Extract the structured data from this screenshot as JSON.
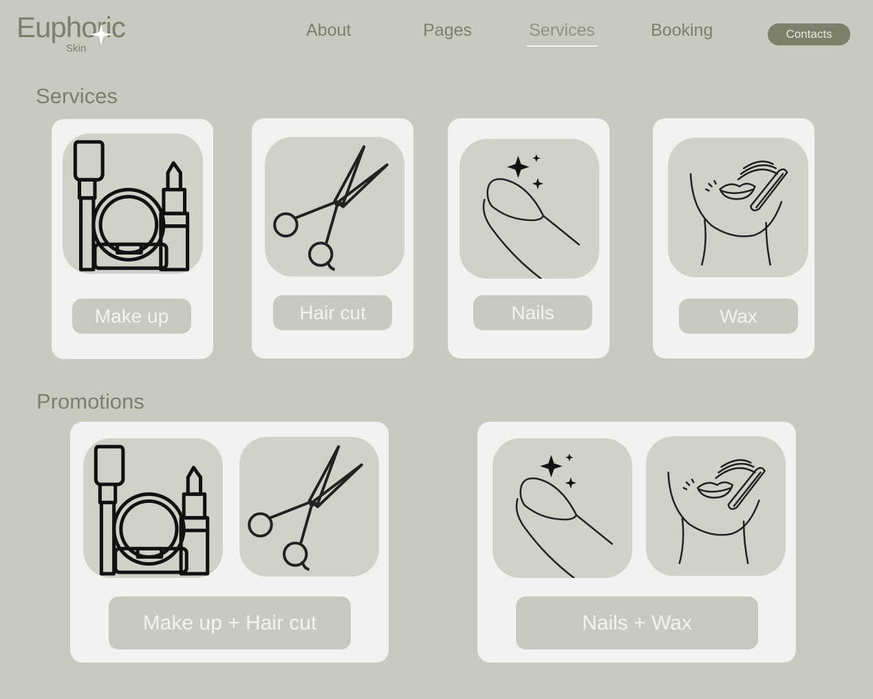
{
  "brand": {
    "name": "Euphoric",
    "sub": "Skin"
  },
  "nav": {
    "about": "About",
    "pages": "Pages",
    "services": "Services",
    "booking": "Booking",
    "contacts": "Contacts"
  },
  "services_section": {
    "title": "Services",
    "items": [
      {
        "label": "Make up",
        "icon": "makeup-icon"
      },
      {
        "label": "Hair cut",
        "icon": "scissors-icon"
      },
      {
        "label": "Nails",
        "icon": "nail-icon"
      },
      {
        "label": "Wax",
        "icon": "wax-icon"
      }
    ]
  },
  "promotions_section": {
    "title": "Promotions",
    "items": [
      {
        "label": "Make up + Hair cut",
        "icons": [
          "makeup-icon",
          "scissors-icon"
        ]
      },
      {
        "label": "Nails + Wax",
        "icons": [
          "nail-icon",
          "wax-icon"
        ]
      }
    ]
  },
  "colors": {
    "background": "#c8cac0",
    "accent": "#7a806a",
    "card": "#f2f2f0",
    "tile": "#d0d2ca"
  }
}
